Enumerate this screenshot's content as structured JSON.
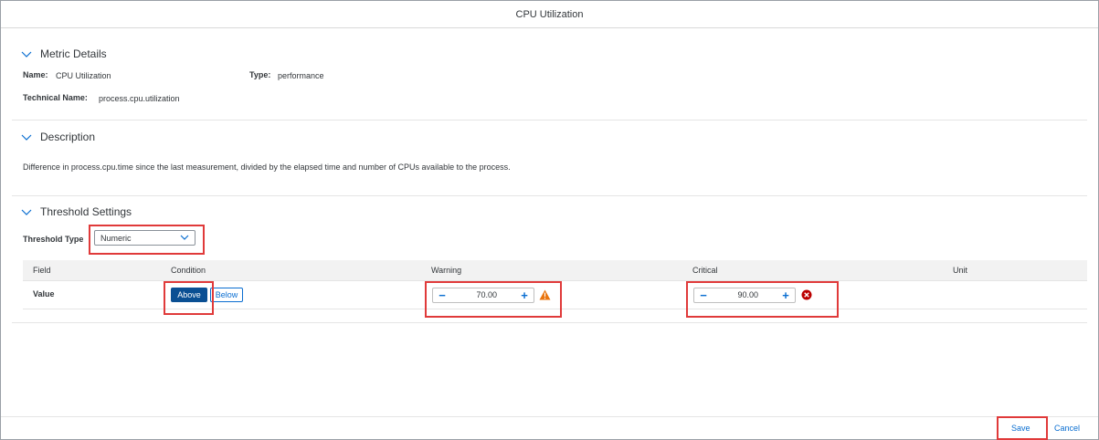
{
  "dialog": {
    "title": "CPU Utilization"
  },
  "metric_details": {
    "title": "Metric Details",
    "name_label": "Name:",
    "name_value": "CPU Utilization",
    "type_label": "Type:",
    "type_value": "performance",
    "technical_label": "Technical Name:",
    "technical_value": "process.cpu.utilization"
  },
  "description": {
    "title": "Description",
    "text": "Difference in process.cpu.time since the last measurement, divided by the elapsed time and number of CPUs available to the process."
  },
  "threshold": {
    "title": "Threshold Settings",
    "type_label": "Threshold Type",
    "type_value": "Numeric",
    "columns": [
      "Field",
      "Condition",
      "Warning",
      "Critical",
      "Unit"
    ],
    "row": {
      "field": "Value",
      "condition_options": [
        "Above",
        "Below"
      ],
      "condition_selected": "Above",
      "warning": "70.00",
      "critical": "90.00"
    }
  },
  "footer": {
    "save_label": "Save",
    "cancel_label": "Cancel"
  },
  "colors": {
    "accent": "#0a6ed1",
    "selected_button": "#0a4f93",
    "warning_icon": "#e9730c",
    "critical_icon": "#bb0000",
    "highlight": "#e03a3a"
  }
}
